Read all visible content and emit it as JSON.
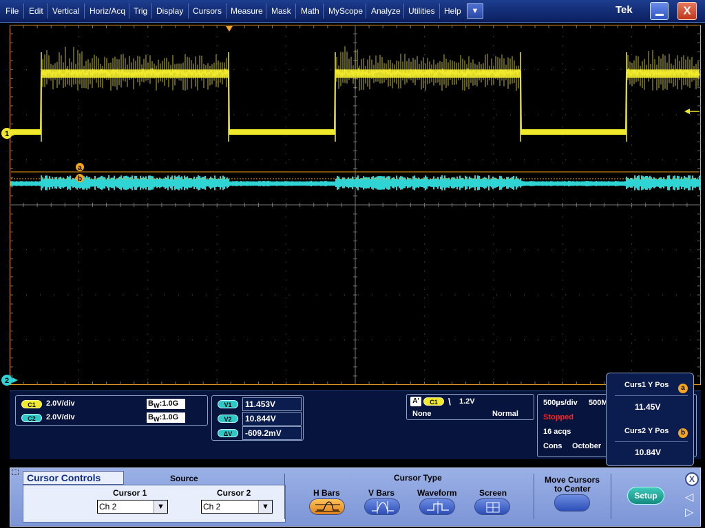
{
  "menu": {
    "items": [
      "File",
      "Edit",
      "Vertical",
      "Horiz/Acq",
      "Trig",
      "Display",
      "Cursors",
      "Measure",
      "Mask",
      "Math",
      "MyScope",
      "Analyze",
      "Utilities",
      "Help"
    ],
    "dropdown_glyph": "▼",
    "logo": "Tek",
    "minimize_icon": "minimize-icon",
    "close_glyph": "X"
  },
  "waveform": {
    "ch1_marker": "1",
    "ch2_marker": "2",
    "cursor_a": "a",
    "cursor_b": "b",
    "ch1_color": "#f1ea2c",
    "ch2_color": "#2fd4d4",
    "cursor_color": "#f5a51f"
  },
  "channels": [
    {
      "chip": "C1",
      "scale": "2.0V/div",
      "bw_prefix": "B",
      "bw_sub": "W",
      "bw": ":1.0G"
    },
    {
      "chip": "C2",
      "scale": "2.0V/div",
      "bw_prefix": "B",
      "bw_sub": "W",
      "bw": ":1.0G"
    }
  ],
  "cursor_readout": [
    {
      "chip": "V1",
      "value": "11.453V"
    },
    {
      "chip": "V2",
      "value": "10.844V"
    },
    {
      "chip": "ΔV",
      "value": "-609.2mV"
    }
  ],
  "trigger": {
    "badge": "A'",
    "source": "C1",
    "slope": "\\",
    "level": "1.2V",
    "coupling": "None",
    "mode": "Normal"
  },
  "acquisition": {
    "timebase": "500µs/div",
    "sample_rate": "500M",
    "state": "Stopped",
    "acqs": "16 acqs",
    "cons": "Cons",
    "month": "October"
  },
  "cursor_popup": {
    "curs1_label": "Curs1 Y Pos",
    "curs1_value": "11.45V",
    "curs1_badge": "a",
    "curs2_label": "Curs2 Y Pos",
    "curs2_value": "10.84V",
    "curs2_badge": "b"
  },
  "controls": {
    "tab_title": "Cursor Controls",
    "source_label": "Source",
    "cursor1_label": "Cursor 1",
    "cursor1_value": "Ch 2",
    "cursor2_label": "Cursor 2",
    "cursor2_value": "Ch 2",
    "combo_arrow": "▼",
    "cursor_type_label": "Cursor Type",
    "types": [
      {
        "label": "H Bars",
        "icon": "hbars-icon",
        "active": true
      },
      {
        "label": "V Bars",
        "icon": "vbars-icon",
        "active": false
      },
      {
        "label": "Waveform",
        "icon": "waveform-icon",
        "active": false
      },
      {
        "label": "Screen",
        "icon": "screen-icon",
        "active": false
      }
    ],
    "move_label_1": "Move Cursors",
    "move_label_2": "to Center",
    "setup_label": "Setup",
    "close_glyph": "X"
  }
}
